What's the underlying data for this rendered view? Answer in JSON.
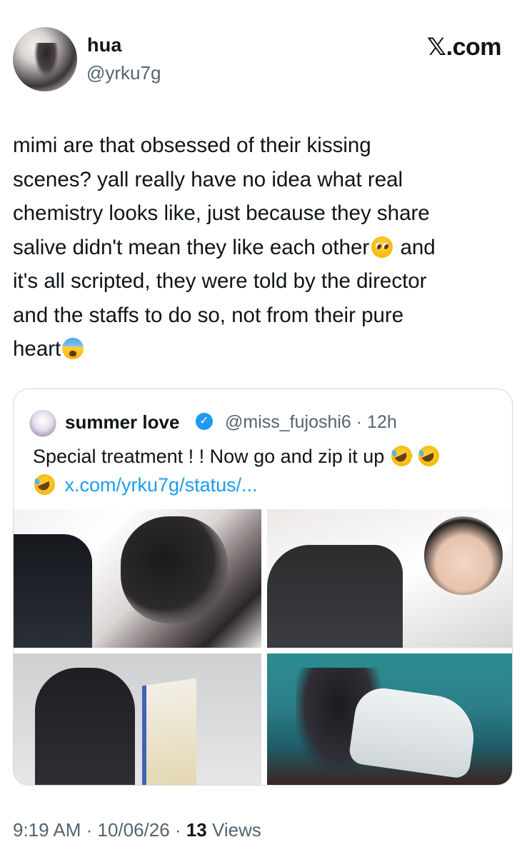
{
  "header": {
    "name": "hua",
    "handle": "@yrku7g",
    "brand": "𝕏.com"
  },
  "tweet": {
    "lines": [
      "mimi are that obsessed of their kissing",
      "scenes? yall really have no idea what real",
      "chemistry looks like, just because they share",
      "salive didn't mean they like each other",
      "and",
      "it's all scripted, they were told by the director",
      "and the staffs to do so, not from their pure",
      "heart"
    ],
    "emojis": [
      "pleading-face-emoji",
      "fearful-face-emoji"
    ]
  },
  "quote": {
    "name": "summer love",
    "verified": true,
    "verified_icon": "✓",
    "handle_time": "@miss_fujoshi6 · 12h",
    "text_line1": "Special treatment ! ! Now go and zip it up",
    "link": "x.com/yrku7g/status/...",
    "emojis": [
      "rofl-emoji",
      "rofl-emoji",
      "rofl-emoji"
    ],
    "photos": [
      "photo-1",
      "photo-2",
      "photo-3",
      "photo-4"
    ]
  },
  "footer": {
    "time": "9:19 AM · 10/06/26 · ",
    "views_count": "13",
    "views_label": " Views"
  },
  "colors": {
    "text": "#0f1419",
    "secondary": "#536471",
    "link": "#1d9bf0",
    "border": "#cfd9de"
  }
}
